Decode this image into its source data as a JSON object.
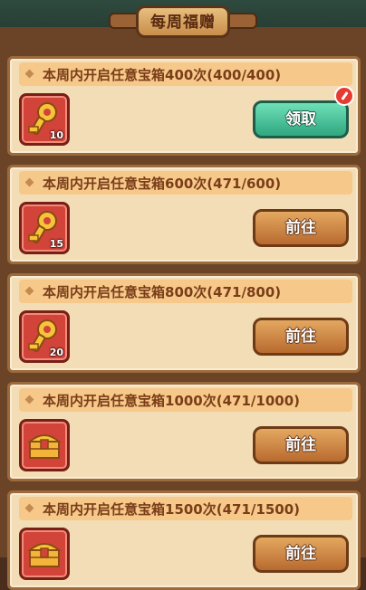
{
  "title": "每周福赠",
  "tasks": [
    {
      "title": "本周内开启任意宝箱400次(400/400)",
      "qty": "10",
      "button": "领取",
      "state": "claim",
      "icon": "gold-key-icon"
    },
    {
      "title": "本周内开启任意宝箱600次(471/600)",
      "qty": "15",
      "button": "前往",
      "state": "go",
      "icon": "gold-key-icon"
    },
    {
      "title": "本周内开启任意宝箱800次(471/800)",
      "qty": "20",
      "button": "前往",
      "state": "go",
      "icon": "gold-key-icon"
    },
    {
      "title": "本周内开启任意宝箱1000次(471/1000)",
      "qty": "",
      "button": "前往",
      "state": "go",
      "icon": "treasure-chest-icon"
    },
    {
      "title": "本周内开启任意宝箱1500次(471/1500)",
      "qty": "",
      "button": "前往",
      "state": "go",
      "icon": "treasure-chest-icon"
    }
  ],
  "colors": {
    "go_button": "#d08a48",
    "claim_button": "#3fc095",
    "badge": "#e63b32"
  }
}
